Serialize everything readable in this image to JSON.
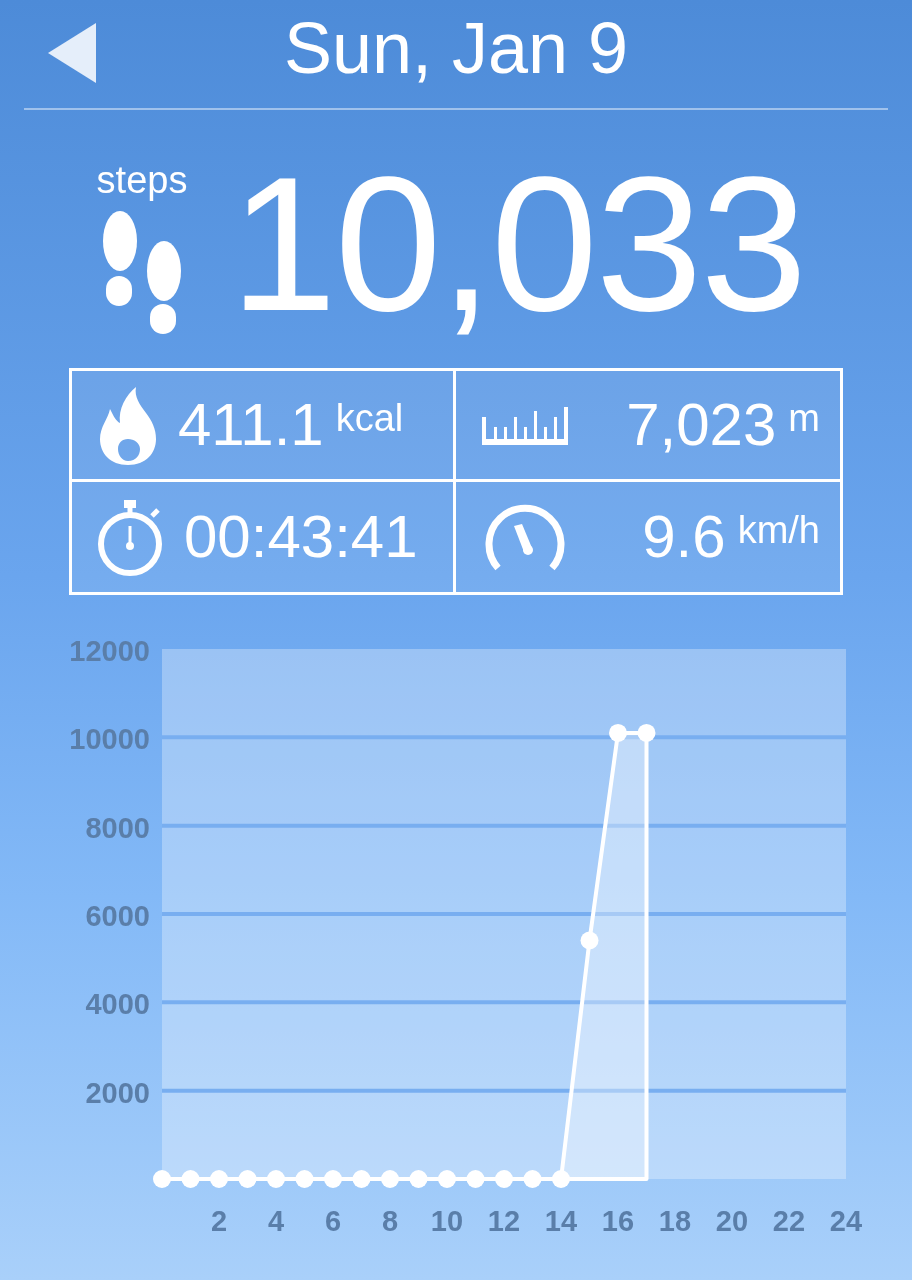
{
  "header": {
    "title": "Sun, Jan 9"
  },
  "steps": {
    "label": "steps",
    "value": "10,033"
  },
  "stats": [
    {
      "kind": "calories",
      "value": "411.1",
      "unit": "kcal"
    },
    {
      "kind": "distance",
      "value": "7,023",
      "unit": "m"
    },
    {
      "kind": "duration",
      "value": "00:43:41"
    },
    {
      "kind": "speed",
      "value": "9.6",
      "unit": "km/h"
    }
  ],
  "chart": {
    "chart_data": {
      "type": "area",
      "x": [
        0,
        1,
        2,
        3,
        4,
        5,
        6,
        7,
        8,
        9,
        10,
        11,
        12,
        13,
        14,
        15,
        16,
        17
      ],
      "series": [
        {
          "color": "#ffffff",
          "values": [
            0,
            0,
            0,
            0,
            0,
            0,
            0,
            0,
            0,
            0,
            0,
            0,
            0,
            0,
            0,
            5400,
            10100,
            10100
          ]
        }
      ],
      "grid": true,
      "xlim": [
        0,
        24
      ],
      "ylim": [
        0,
        12000
      ],
      "xticks": [
        2,
        4,
        6,
        8,
        10,
        12,
        14,
        16,
        18,
        20,
        22,
        24
      ],
      "yticks": [
        2000,
        4000,
        6000,
        8000,
        10000,
        12000
      ]
    }
  }
}
